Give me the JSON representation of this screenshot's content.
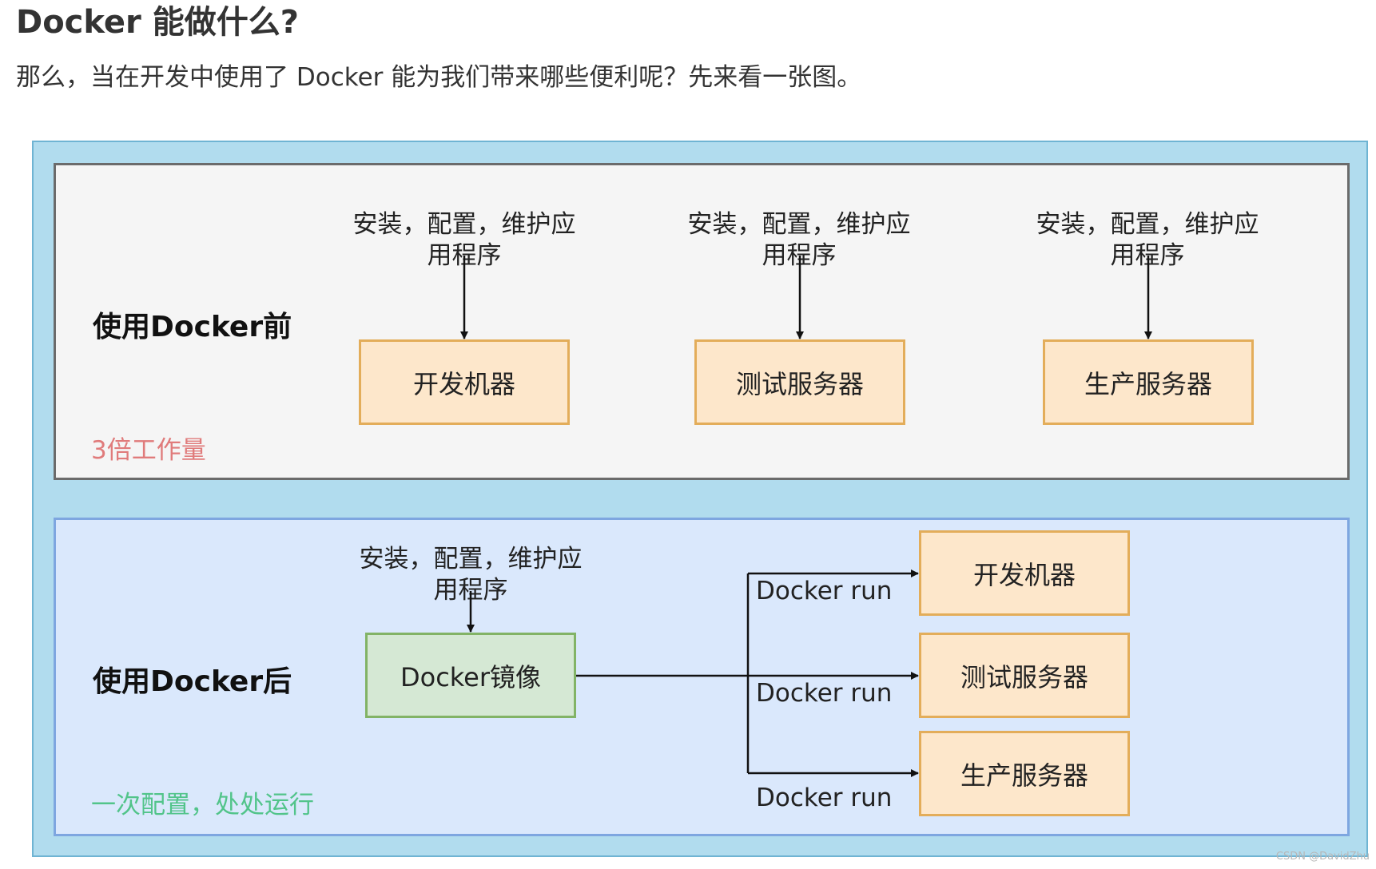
{
  "article": {
    "heading": "Docker 能做什么?",
    "intro": "那么，当在开发中使用了 Docker 能为我们带来哪些便利呢？先来看一张图。"
  },
  "diagram": {
    "before": {
      "title": "使用Docker前",
      "note": "3倍工作量",
      "steps": [
        {
          "label": "安装，配置，维护应用程序",
          "target": "开发机器"
        },
        {
          "label": "安装，配置，维护应用程序",
          "target": "测试服务器"
        },
        {
          "label": "安装，配置，维护应用程序",
          "target": "生产服务器"
        }
      ]
    },
    "after": {
      "title": "使用Docker后",
      "note": "一次配置，处处运行",
      "step_label": "安装，配置，维护应用程序",
      "image_box": "Docker镜像",
      "run_label": "Docker run",
      "targets": [
        "开发机器",
        "测试服务器",
        "生产服务器"
      ]
    }
  },
  "watermark": "CSDN @DavidZhu",
  "colors": {
    "outer_fill": "#b1dcee",
    "before_panel_fill": "#f5f5f5",
    "after_panel_fill": "#dae8fc",
    "target_box_fill": "#fde7cb",
    "target_box_border": "#e3ad5a",
    "image_box_fill": "#d5e8d4",
    "image_box_border": "#82b366",
    "note_red": "#e07b7b",
    "note_green": "#52c48a"
  }
}
